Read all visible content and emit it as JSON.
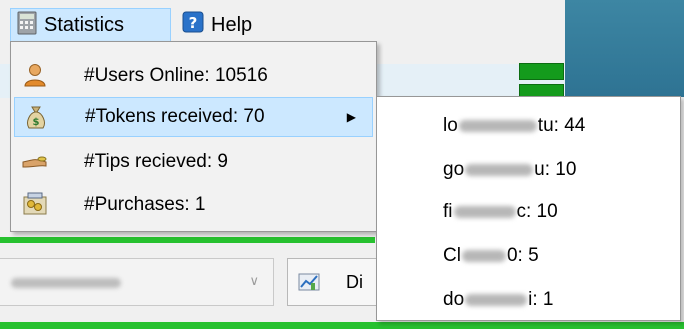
{
  "menubar": {
    "statistics_label": "Statistics",
    "help_label": "Help",
    "help_icon": "help-question-icon",
    "statistics_icon": "calculator-icon"
  },
  "statistics_menu": {
    "items": [
      {
        "label": "#Users Online: 10516",
        "icon": "user-icon"
      },
      {
        "label": "#Tokens received: 70",
        "icon": "money-bag-icon"
      },
      {
        "label": "#Tips recieved: 9",
        "icon": "hand-coin-icon"
      },
      {
        "label": "#Purchases: 1",
        "icon": "coins-box-icon"
      }
    ]
  },
  "tokens_submenu": {
    "items": [
      {
        "prefix": "lo",
        "suffix": "tu: 44"
      },
      {
        "prefix": "go",
        "suffix": "u: 10"
      },
      {
        "prefix": "fi",
        "suffix": "c: 10"
      },
      {
        "prefix": "Cl",
        "suffix": "0: 5"
      },
      {
        "prefix": "do",
        "suffix": "i: 1"
      }
    ]
  },
  "background": {
    "display_button_label": "Di",
    "accent_green": "#27c12f",
    "accent_blue": "#2f7a99",
    "highlight": "#cce8ff"
  }
}
